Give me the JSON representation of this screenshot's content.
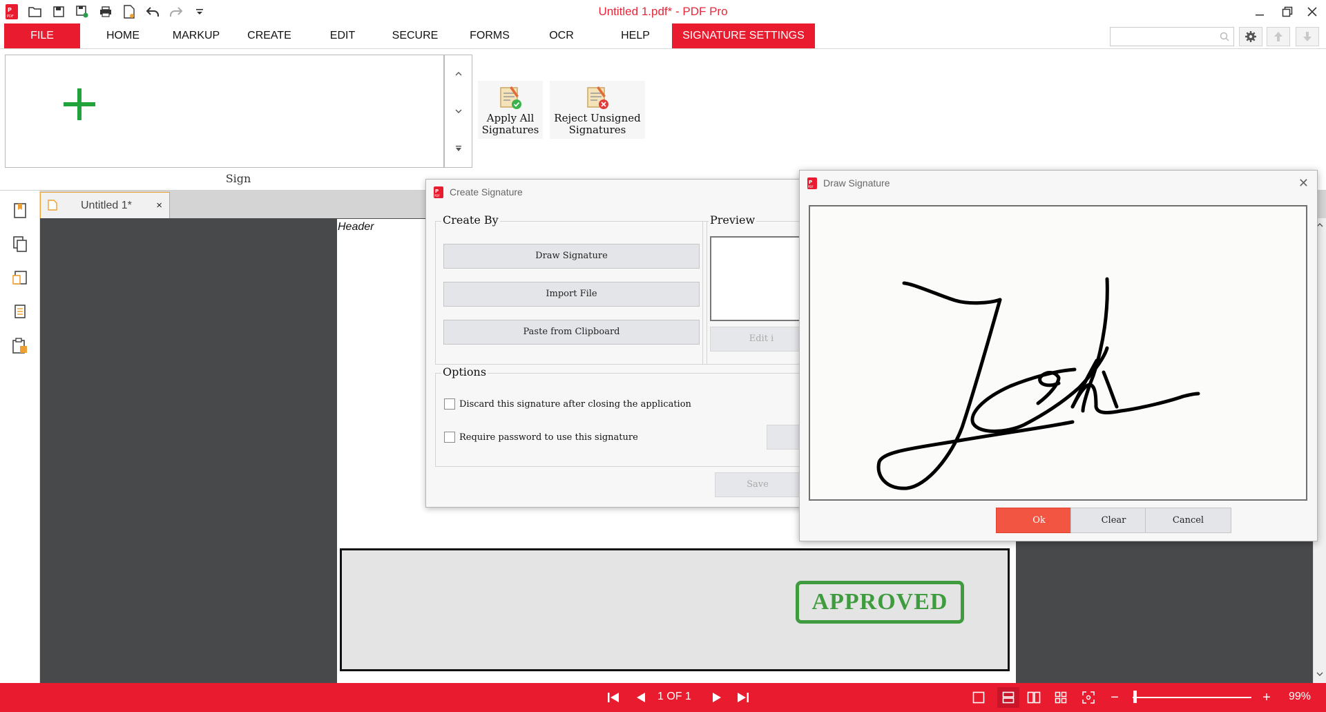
{
  "app": {
    "title": "Untitled 1.pdf* - PDF Pro"
  },
  "quick_access": {
    "icons": [
      "app-logo-icon",
      "open-icon",
      "save-icon",
      "save-as-icon",
      "print-icon",
      "new-document-icon",
      "undo-icon",
      "redo-icon",
      "customize-icon"
    ]
  },
  "menu": {
    "file": "FILE",
    "home": "HOME",
    "markup": "MARKUP",
    "create": "CREATE",
    "edit": "EDIT",
    "secure": "SECURE",
    "forms": "FORMS",
    "ocr": "OCR",
    "help": "HELP",
    "signature_settings": "SIGNATURE SETTINGS"
  },
  "search": {
    "value": "",
    "placeholder": ""
  },
  "ribbon": {
    "sign_group_label": "Sign",
    "apply_all_label": "Apply All\nSignatures",
    "reject_unsigned_label": "Reject Unsigned\nSignatures"
  },
  "document": {
    "tab_label": "Untitled 1*",
    "tab_close": "×",
    "header_text": "Header",
    "stamp_text": "APPROVED"
  },
  "statusbar": {
    "page_indicator": "1 OF 1",
    "zoom_level": "99%",
    "zoom_out": "−",
    "zoom_in": "+"
  },
  "create_signature": {
    "title": "Create Signature",
    "create_by_legend": "Create By",
    "draw_signature": "Draw Signature",
    "import_file": "Import File",
    "paste_clipboard": "Paste from Clipboard",
    "preview_legend": "Preview",
    "edit_button": "Edit i",
    "options_legend": "Options",
    "discard_option": "Discard this signature after closing the application",
    "require_password_option": "Require password to use this signature",
    "save_button": "Save",
    "discard_checked": false,
    "require_password_checked": false
  },
  "draw_signature": {
    "title": "Draw Signature",
    "close": "✕",
    "ok_button": "Ok",
    "clear_button": "Clear",
    "cancel_button": "Cancel"
  },
  "colors": {
    "accent_red": "#e81c2e",
    "title_red": "#e5283a",
    "stamp_green": "#3e9b3e",
    "ok_button": "#f25542",
    "document_background": "#48494b"
  }
}
